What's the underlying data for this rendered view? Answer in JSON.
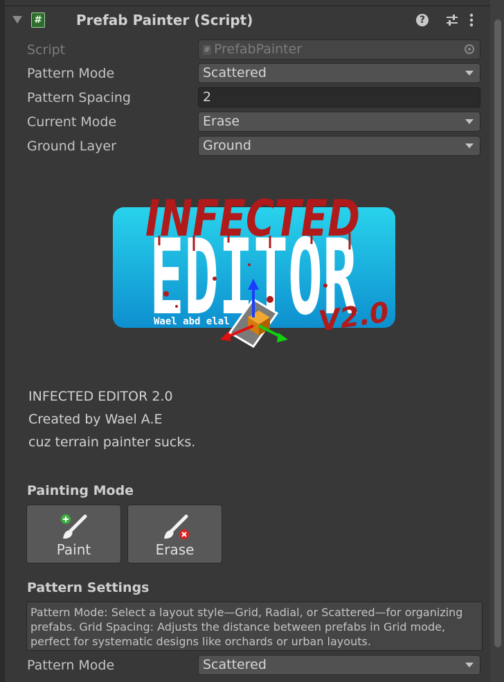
{
  "header": {
    "title": "Prefab Painter (Script)",
    "icons": [
      "foldout-arrow",
      "script-icon",
      "help-icon",
      "presets-icon",
      "more-icon"
    ]
  },
  "fields": [
    {
      "label": "Script",
      "value": "PrefabPainter",
      "kind": "object"
    },
    {
      "label": "Pattern Mode",
      "value": "Scattered",
      "kind": "dropdown"
    },
    {
      "label": "Pattern Spacing",
      "value": "2",
      "kind": "text"
    },
    {
      "label": "Current Mode",
      "value": "Erase",
      "kind": "dropdown"
    },
    {
      "label": "Ground Layer",
      "value": "Ground",
      "kind": "dropdown"
    }
  ],
  "logo": {
    "top_text": "INFECTED",
    "main_text": "EDITOR",
    "byline": "Wael abd elal",
    "version": "V2.0",
    "colors": {
      "panel": "#1fb4e0",
      "blood": "#b01a1a"
    }
  },
  "info": {
    "line1": "INFECTED EDITOR 2.0",
    "line2": "Created by Wael A.E",
    "line3": "cuz terrain painter sucks."
  },
  "painting_mode": {
    "title": "Painting Mode",
    "paint_label": "Paint",
    "erase_label": "Erase"
  },
  "pattern_settings": {
    "title": "Pattern Settings",
    "help_text": "Pattern Mode: Select a layout style—Grid, Radial, or Scattered—for organizing prefabs. Grid Spacing: Adjusts the distance between prefabs in Grid mode, perfect for systematic designs like orchards or urban layouts.",
    "mode_label": "Pattern Mode",
    "mode_value": "Scattered"
  }
}
